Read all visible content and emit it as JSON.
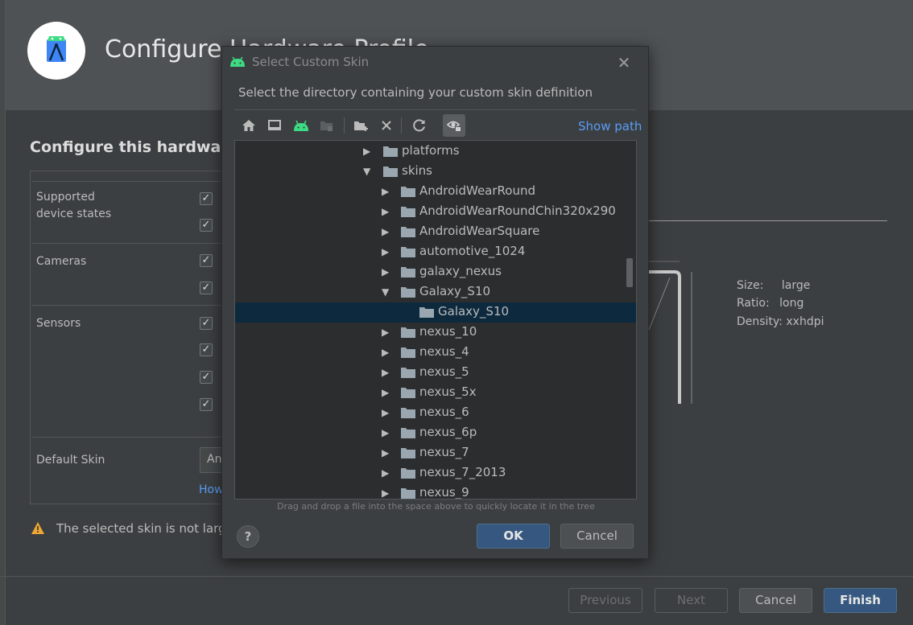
{
  "background": {
    "title": "Configure Hardware Profile",
    "section_title": "Configure this hardware",
    "labels": {
      "supported_device_states": "Supported\ndevice states",
      "cameras": "Cameras",
      "sensors": "Sensors",
      "default_skin": "Default Skin"
    },
    "default_skin_value": "An",
    "how_link": "How",
    "warning": "The selected skin is not large",
    "preview_specs": {
      "size_label": "Size:",
      "size_value": "large",
      "ratio_label": "Ratio:",
      "ratio_value": "long",
      "density_label": "Density:",
      "density_value": "xxhdpi"
    },
    "buttons": {
      "previous": "Previous",
      "next": "Next",
      "cancel": "Cancel",
      "finish": "Finish"
    },
    "colors": {
      "accent": "#365880",
      "link": "#589df6",
      "warning": "#f0a732"
    }
  },
  "dialog": {
    "title": "Select Custom Skin",
    "description": "Select the directory containing your custom skin definition",
    "show_path": "Show path",
    "toolbar_icons": [
      "home-icon",
      "desktop-icon",
      "android-icon",
      "module-icon",
      "new-folder-icon",
      "delete-icon",
      "refresh-icon",
      "show-hidden-icon"
    ],
    "tree": [
      {
        "label": "platforms",
        "expanded": false
      },
      {
        "label": "skins",
        "expanded": true
      },
      {
        "label": "AndroidWearRound",
        "expanded": false
      },
      {
        "label": "AndroidWearRoundChin320x290",
        "expanded": false
      },
      {
        "label": "AndroidWearSquare",
        "expanded": false
      },
      {
        "label": "automotive_1024",
        "expanded": false
      },
      {
        "label": "galaxy_nexus",
        "expanded": false
      },
      {
        "label": "Galaxy_S10",
        "expanded": true
      },
      {
        "label": "Galaxy_S10",
        "selected": true
      },
      {
        "label": "nexus_10",
        "expanded": false
      },
      {
        "label": "nexus_4",
        "expanded": false
      },
      {
        "label": "nexus_5",
        "expanded": false
      },
      {
        "label": "nexus_5x",
        "expanded": false
      },
      {
        "label": "nexus_6",
        "expanded": false
      },
      {
        "label": "nexus_6p",
        "expanded": false
      },
      {
        "label": "nexus_7",
        "expanded": false
      },
      {
        "label": "nexus_7_2013",
        "expanded": false
      },
      {
        "label": "nexus_9",
        "expanded": false
      }
    ],
    "drag_hint": "Drag and drop a file into the space above to quickly locate it in the tree",
    "help": "?",
    "ok": "OK",
    "cancel": "Cancel"
  }
}
